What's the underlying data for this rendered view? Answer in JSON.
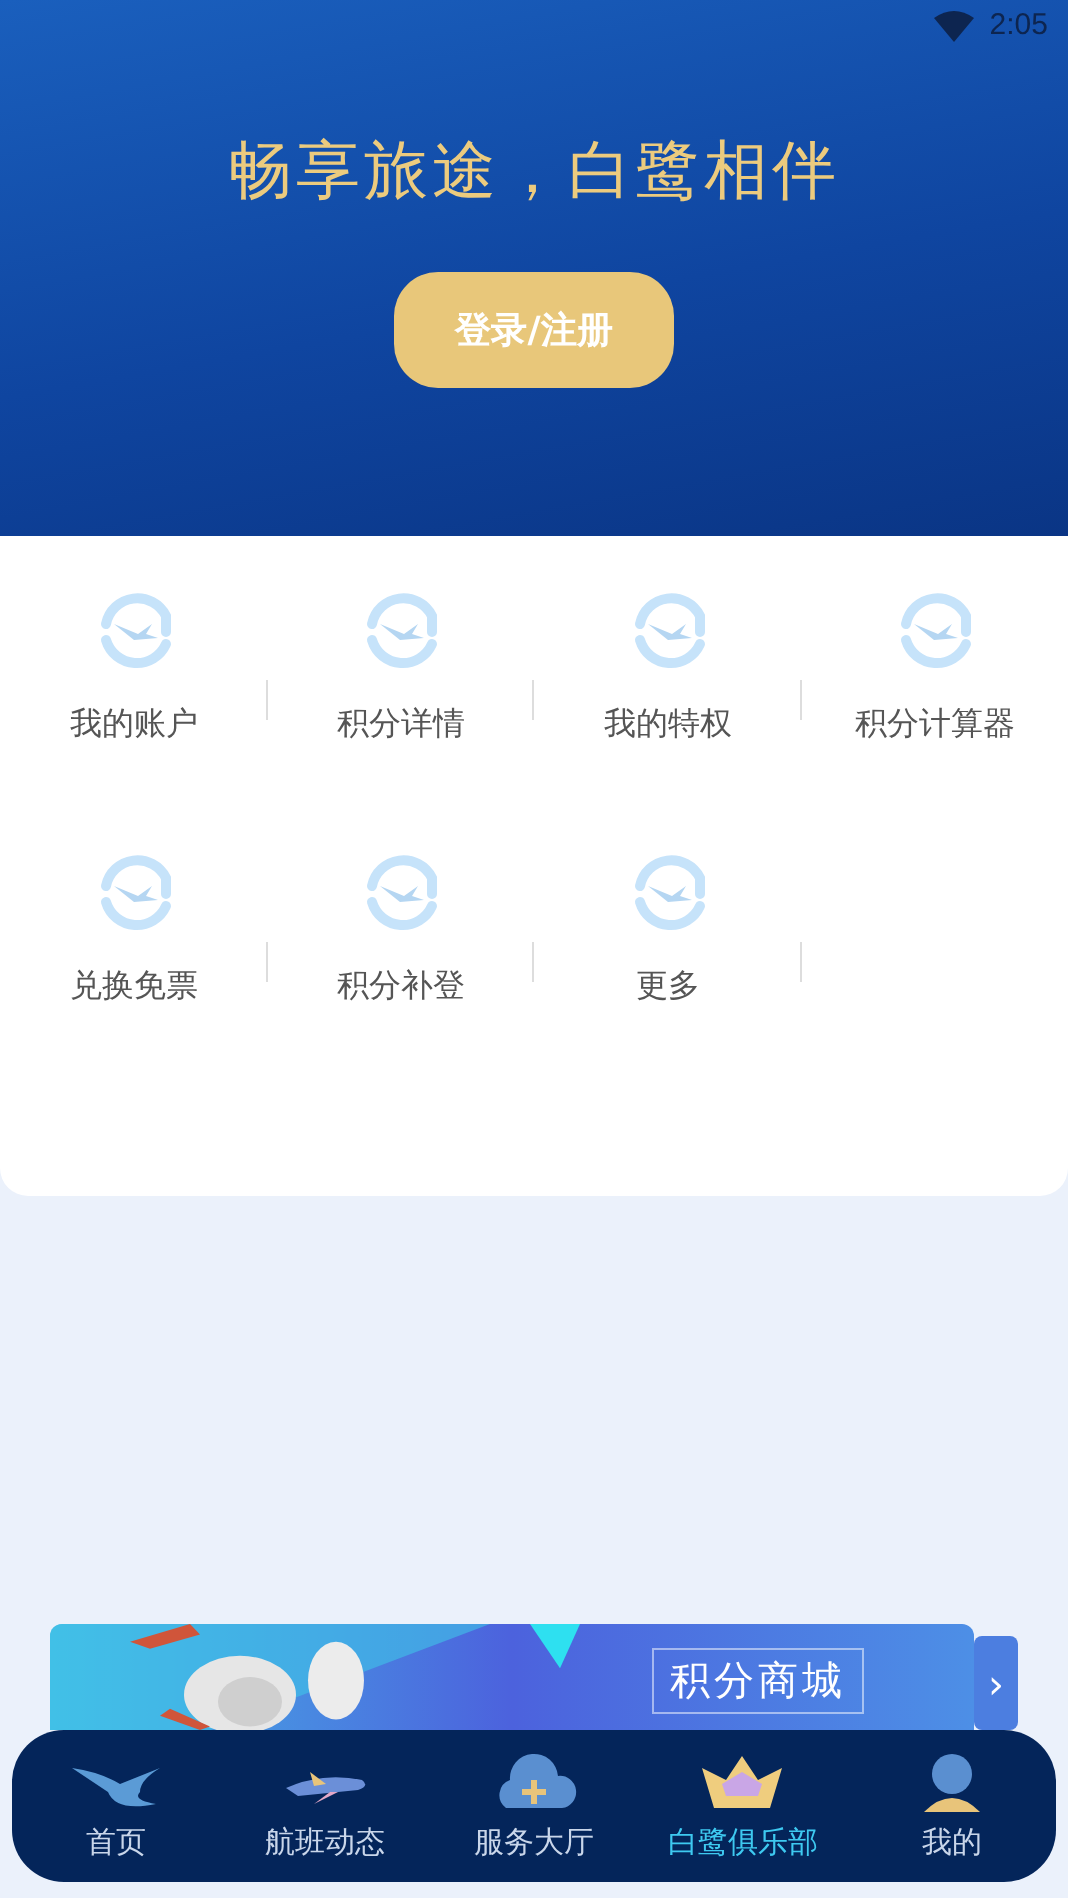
{
  "status_bar": {
    "time": "2:05"
  },
  "header": {
    "slogan": "畅享旅途，白鹭相伴",
    "login_button": "登录/注册"
  },
  "menu": {
    "items": [
      {
        "label": "我的账户"
      },
      {
        "label": "积分详情"
      },
      {
        "label": "我的特权"
      },
      {
        "label": "积分计算器"
      },
      {
        "label": "兑换免票"
      },
      {
        "label": "积分补登"
      },
      {
        "label": "更多"
      }
    ]
  },
  "banner": {
    "title": "积分商城",
    "more": "›"
  },
  "tab_bar": [
    {
      "label": "首页",
      "kind": "home",
      "selected": false
    },
    {
      "label": "航班动态",
      "kind": "plane",
      "selected": false
    },
    {
      "label": "服务大厅",
      "kind": "cloud",
      "selected": false
    },
    {
      "label": "白鹭俱乐部",
      "kind": "crown",
      "selected": true
    },
    {
      "label": "我的",
      "kind": "person",
      "selected": false
    }
  ]
}
